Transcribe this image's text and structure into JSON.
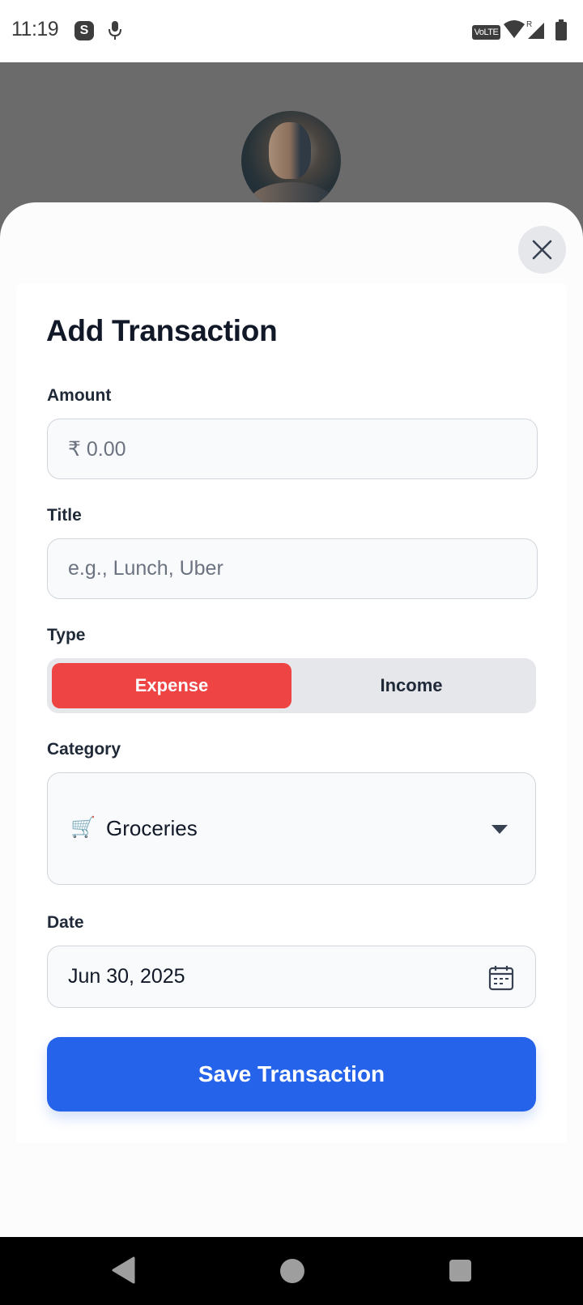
{
  "status_bar": {
    "time": "11:19",
    "app_icon_letter": "S",
    "volte": "VoLTE",
    "roaming": "R"
  },
  "dialog": {
    "title": "Add Transaction",
    "close_icon": "close-icon",
    "amount": {
      "label": "Amount",
      "placeholder": "₹ 0.00"
    },
    "title_field": {
      "label": "Title",
      "placeholder": "e.g., Lunch, Uber"
    },
    "type": {
      "label": "Type",
      "options": [
        "Expense",
        "Income"
      ],
      "selected": "Expense"
    },
    "category": {
      "label": "Category",
      "emoji": "🛒",
      "selected": "Groceries",
      "icon": "chevron-down-icon"
    },
    "date": {
      "label": "Date",
      "value": "Jun 30, 2025",
      "icon": "calendar-icon"
    },
    "save_label": "Save Transaction"
  },
  "colors": {
    "accent": "#2563eb",
    "expense": "#ef4444",
    "text_primary": "#111827"
  },
  "nav": {
    "back_icon": "back-triangle-icon",
    "home_icon": "home-circle-icon",
    "recents_icon": "recents-square-icon"
  }
}
